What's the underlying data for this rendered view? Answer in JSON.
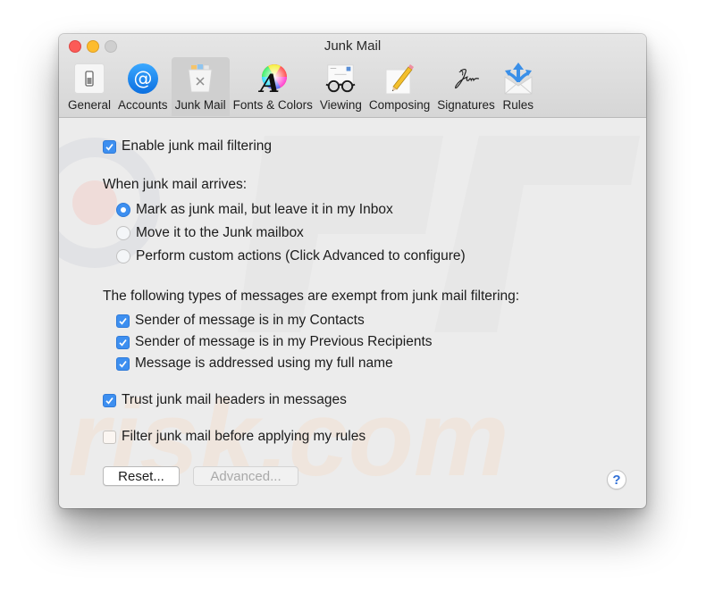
{
  "window": {
    "title": "Junk Mail",
    "controls": [
      "close",
      "minimize",
      "zoom"
    ]
  },
  "toolbar": {
    "items": [
      {
        "label": "General",
        "icon": "general-switch-icon",
        "active": false
      },
      {
        "label": "Accounts",
        "icon": "at-sign-icon",
        "active": false
      },
      {
        "label": "Junk Mail",
        "icon": "junk-bin-icon",
        "active": true
      },
      {
        "label": "Fonts & Colors",
        "icon": "font-color-wheel-icon",
        "active": false
      },
      {
        "label": "Viewing",
        "icon": "glasses-letter-icon",
        "active": false
      },
      {
        "label": "Composing",
        "icon": "pencil-paper-icon",
        "active": false
      },
      {
        "label": "Signatures",
        "icon": "signature-icon",
        "active": false
      },
      {
        "label": "Rules",
        "icon": "envelope-arrows-icon",
        "active": false
      }
    ]
  },
  "junk": {
    "enable_filtering": {
      "label": "Enable junk mail filtering",
      "checked": true
    },
    "arrival_heading": "When junk mail arrives:",
    "arrival_options": [
      {
        "label": "Mark as junk mail, but leave it in my Inbox",
        "selected": true
      },
      {
        "label": "Move it to the Junk mailbox",
        "selected": false
      },
      {
        "label": "Perform custom actions (Click Advanced to configure)",
        "selected": false
      }
    ],
    "exempt_heading": "The following types of messages are exempt from junk mail filtering:",
    "exempt_options": [
      {
        "label": "Sender of message is in my Contacts",
        "checked": true
      },
      {
        "label": "Sender of message is in my Previous Recipients",
        "checked": true
      },
      {
        "label": "Message is addressed using my full name",
        "checked": true
      }
    ],
    "trust_headers": {
      "label": "Trust junk mail headers in messages",
      "checked": true
    },
    "filter_before_rules": {
      "label": "Filter junk mail before applying my rules",
      "checked": false
    }
  },
  "buttons": {
    "reset_label": "Reset...",
    "advanced_label": "Advanced...",
    "advanced_enabled": false,
    "help_label": "?"
  },
  "colors": {
    "accent": "#3d8ff0",
    "close": "#fc5b57",
    "minimize": "#fdbc2e",
    "zoom": "#cfcfcf",
    "window_bg": "#ececec"
  }
}
